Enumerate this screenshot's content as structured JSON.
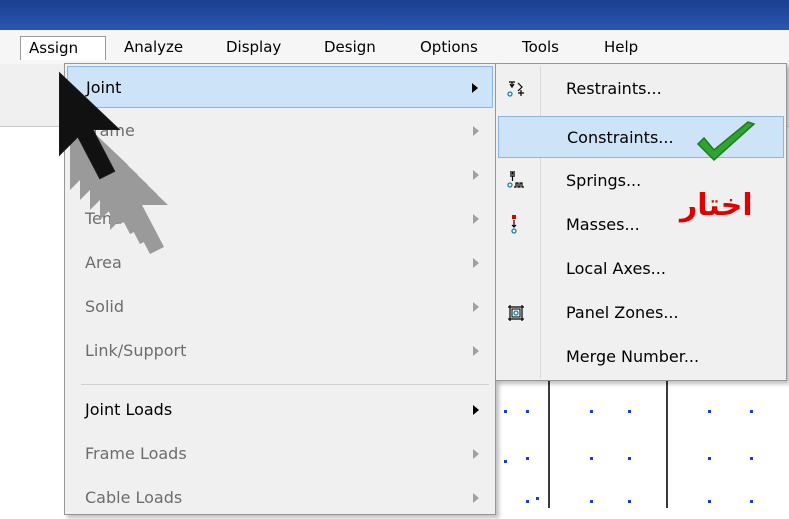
{
  "menubar": {
    "items": [
      {
        "label": "Assign"
      },
      {
        "label": "Analyze"
      },
      {
        "label": "Display"
      },
      {
        "label": "Design"
      },
      {
        "label": "Options"
      },
      {
        "label": "Tools"
      },
      {
        "label": "Help"
      }
    ]
  },
  "assign_menu": {
    "items": [
      {
        "label": "Joint",
        "state": "highlighted"
      },
      {
        "label": "Frame",
        "state": "disabled"
      },
      {
        "label": "Cable",
        "state": "disabled"
      },
      {
        "label": "Tendon",
        "state": "disabled"
      },
      {
        "label": "Area",
        "state": "disabled"
      },
      {
        "label": "Solid",
        "state": "disabled"
      },
      {
        "label": "Link/Support",
        "state": "disabled"
      },
      {
        "label": "Joint Loads",
        "state": "enabled"
      },
      {
        "label": "Frame Loads",
        "state": "disabled"
      },
      {
        "label": "Cable Loads",
        "state": "disabled"
      }
    ]
  },
  "joint_submenu": {
    "items": [
      {
        "label": "Restraints...",
        "icon": "restraints-icon"
      },
      {
        "label": "Constraints...",
        "icon": "",
        "state": "highlighted"
      },
      {
        "label": "Springs...",
        "icon": "springs-icon"
      },
      {
        "label": "Masses...",
        "icon": "masses-icon"
      },
      {
        "label": "Local Axes...",
        "icon": ""
      },
      {
        "label": "Panel Zones...",
        "icon": "panel-zones-icon"
      },
      {
        "label": "Merge Number...",
        "icon": ""
      }
    ]
  },
  "annotation": {
    "text": "اختار",
    "color": "#e10000",
    "check_color": "#2ea52e"
  }
}
